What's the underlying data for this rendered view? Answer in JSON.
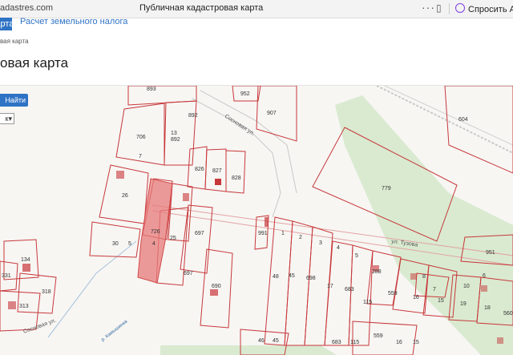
{
  "browser": {
    "url": "adastres.com",
    "tab_title": "Публичная кадастровая карта",
    "menu_glyph": "···",
    "bookmark_glyph": "▯",
    "ask_label": "Спросить Ал"
  },
  "nav": {
    "active_tab": "Карта",
    "link": "Расчет земельного налога"
  },
  "breadcrumb": "вая карта",
  "page_title": "овая карта",
  "search_button": "Найти",
  "layer_select": "к",
  "map": {
    "streets": [
      "Сосновая ул.",
      "ул. Тузова",
      "Сосновая ул."
    ],
    "river": "р. Камышинка",
    "plots": [
      "893",
      "952",
      "907",
      "604",
      "706",
      "892",
      "892",
      "13",
      "7",
      "826",
      "827",
      "828",
      "779",
      "26",
      "726",
      "697",
      "991",
      "30",
      "5",
      "4",
      "25",
      "1",
      "2",
      "3",
      "4",
      "5",
      "697",
      "690",
      "48",
      "45",
      "698",
      "17",
      "683",
      "115",
      "288",
      "559",
      "16",
      "15",
      "19",
      "18",
      "951",
      "134",
      "331",
      "318",
      "313",
      "46",
      "45",
      "683",
      "115",
      "559",
      "16",
      "15",
      "6",
      "10",
      "7",
      "8",
      "560"
    ]
  }
}
